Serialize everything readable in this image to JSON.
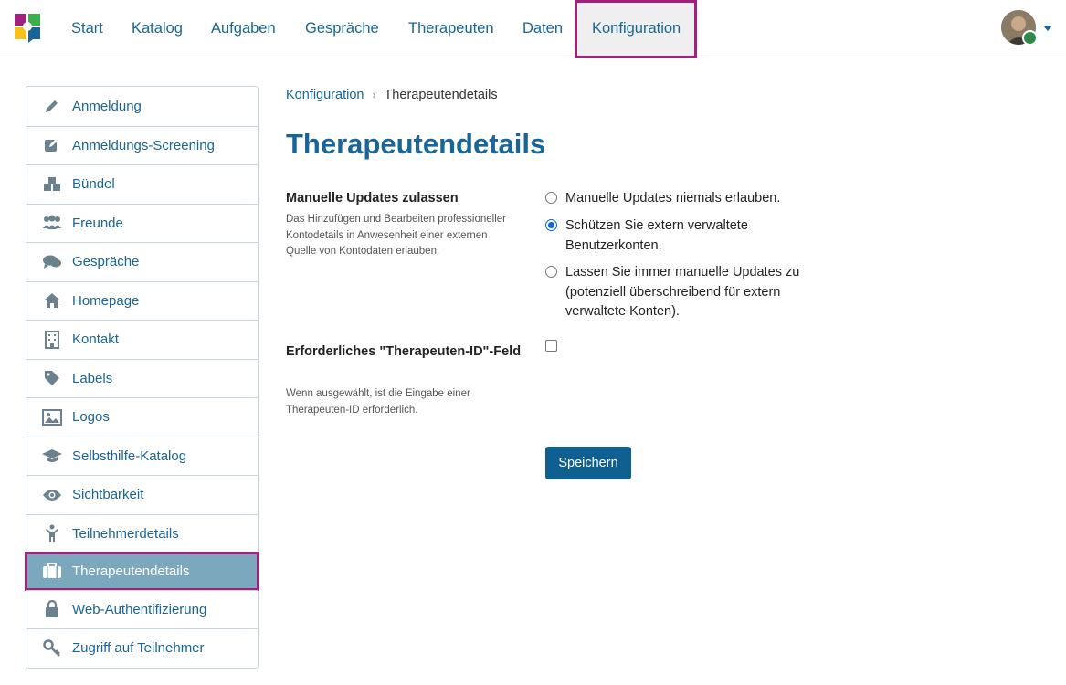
{
  "nav": {
    "items": [
      {
        "label": "Start"
      },
      {
        "label": "Katalog"
      },
      {
        "label": "Aufgaben"
      },
      {
        "label": "Gespräche"
      },
      {
        "label": "Therapeuten"
      },
      {
        "label": "Daten"
      },
      {
        "label": "Konfiguration",
        "active": true
      }
    ]
  },
  "sidebar": {
    "items": [
      {
        "label": "Anmeldung",
        "icon": "pencil-icon"
      },
      {
        "label": "Anmeldungs-Screening",
        "icon": "edit-square-icon"
      },
      {
        "label": "Bündel",
        "icon": "cubes-icon"
      },
      {
        "label": "Freunde",
        "icon": "users-icon"
      },
      {
        "label": "Gespräche",
        "icon": "comments-icon"
      },
      {
        "label": "Homepage",
        "icon": "home-icon"
      },
      {
        "label": "Kontakt",
        "icon": "building-icon"
      },
      {
        "label": "Labels",
        "icon": "tag-icon"
      },
      {
        "label": "Logos",
        "icon": "image-icon"
      },
      {
        "label": "Selbsthilfe-Katalog",
        "icon": "graduation-cap-icon"
      },
      {
        "label": "Sichtbarkeit",
        "icon": "eye-icon"
      },
      {
        "label": "Teilnehmerdetails",
        "icon": "child-icon"
      },
      {
        "label": "Therapeutendetails",
        "icon": "suitcase-icon",
        "active": true
      },
      {
        "label": "Web-Authentifizierung",
        "icon": "lock-icon"
      },
      {
        "label": "Zugriff auf Teilnehmer",
        "icon": "key-icon"
      }
    ]
  },
  "breadcrumb": {
    "parent": "Konfiguration",
    "current": "Therapeutendetails"
  },
  "page": {
    "title": "Therapeutendetails"
  },
  "form": {
    "manual_updates": {
      "label": "Manuelle Updates zulassen",
      "help": "Das Hinzufügen und Bearbeiten professioneller Kontodetails in Anwesenheit einer externen Quelle von Kontodaten erlauben.",
      "options": [
        {
          "label": "Manuelle Updates niemals erlauben.",
          "checked": false
        },
        {
          "label": "Schützen Sie extern verwaltete Benutzerkonten.",
          "checked": true
        },
        {
          "label": "Lassen Sie immer manuelle Updates zu (potenziell überschreibend für extern verwaltete Konten).",
          "checked": false
        }
      ]
    },
    "therapist_id": {
      "label": "Erforderliches \"Therapeuten-ID\"-Feld",
      "help": "Wenn ausgewählt, ist die Eingabe einer Therapeuten-ID erforderlich.",
      "checked": false
    },
    "save_label": "Speichern"
  },
  "colors": {
    "link": "#1a6597",
    "highlight": "#a0217e",
    "active_sidebar": "#7ca8bd",
    "button": "#0f5f91"
  }
}
